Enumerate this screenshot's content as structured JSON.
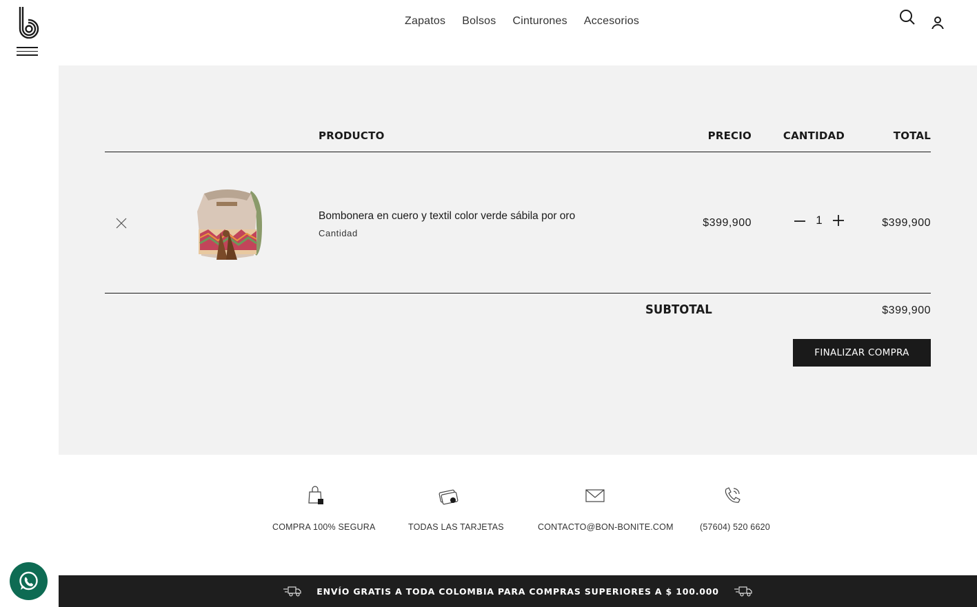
{
  "nav": {
    "items": [
      "Zapatos",
      "Bolsos",
      "Cinturones",
      "Accesorios"
    ]
  },
  "cart": {
    "headers": {
      "product": "PRODUCTO",
      "price": "PRECIO",
      "quantity": "CANTIDAD",
      "total": "TOTAL"
    },
    "item": {
      "name": "Bombonera en cuero y textil color verde sábila por oro",
      "sub_label": "Cantidad",
      "price": "$399,900",
      "quantity": "1",
      "total": "$399,900"
    },
    "subtotal_label": "SUBTOTAL",
    "subtotal_value": "$399,900",
    "checkout_label": "FINALIZAR COMPRA"
  },
  "features": [
    {
      "label": "COMPRA 100% SEGURA",
      "icon": "secure-bag-icon"
    },
    {
      "label": "TODAS LAS TARJETAS",
      "icon": "credit-cards-icon"
    },
    {
      "label": "CONTACTO@BON-BONITE.COM",
      "icon": "mail-icon"
    },
    {
      "label": "(57604) 520 6620",
      "icon": "phone-icon"
    }
  ],
  "shipping_banner": "ENVÍO GRATIS A TODA COLOMBIA PARA COMPRAS SUPERIORES A $ 100.000"
}
